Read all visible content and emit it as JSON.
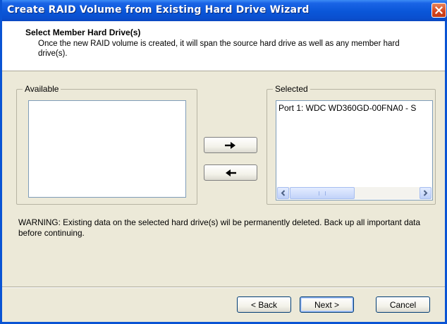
{
  "window": {
    "title": "Create RAID Volume from Existing Hard Drive Wizard"
  },
  "header": {
    "title": "Select Member Hard Drive(s)",
    "description": "Once the new RAID volume is created, it will span the source hard drive as well as any member hard drive(s)."
  },
  "available": {
    "label": "Available",
    "items": []
  },
  "selected": {
    "label": "Selected",
    "items": [
      "Port 1: WDC WD360GD-00FNA0 - S"
    ]
  },
  "transfer": {
    "add_icon": "right-arrow-icon",
    "remove_icon": "left-arrow-icon"
  },
  "warning": "WARNING: Existing data on the selected hard drive(s) wil be permanently deleted. Back up all important data before continuing.",
  "buttons": {
    "back": "< Back",
    "next": "Next >",
    "cancel": "Cancel"
  },
  "colors": {
    "titlebar": "#0a56d8",
    "close_button": "#d5441e",
    "dialog_background": "#ece9d8"
  }
}
